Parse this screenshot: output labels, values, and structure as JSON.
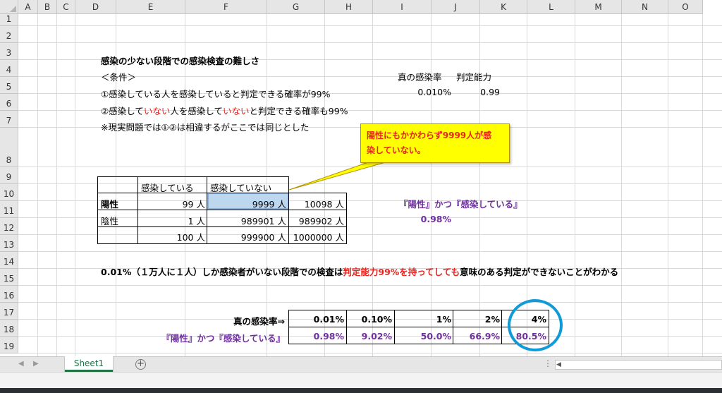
{
  "columns": [
    "A",
    "B",
    "C",
    "D",
    "E",
    "F",
    "G",
    "H",
    "I",
    "J",
    "K",
    "L",
    "M",
    "N",
    "O"
  ],
  "rows": [
    "1",
    "2",
    "3",
    "4",
    "5",
    "6",
    "7",
    "8",
    "9",
    "10",
    "11",
    "12",
    "13",
    "14",
    "15",
    "16",
    "17",
    "18",
    "19"
  ],
  "title": "感染の少ない段階での感染検査の難しさ",
  "conditions_label": "＜条件＞",
  "cond1": "①感染している人を感染していると判定できる確率が99%",
  "cond2": {
    "p1": "②感染して",
    "p2": "いない",
    "p3": "人を感染して",
    "p4": "いない",
    "p5": "と判定できる確率も99%"
  },
  "cond3": "※現実問題では①②は相違するがここでは同じとした",
  "params": {
    "rate_label": "真の感染率",
    "ability_label": "判定能力",
    "rate_value": "0.010%",
    "ability_value": "0.99"
  },
  "callout": {
    "line1": "陽性にもかかわらず9999人が感",
    "line2": "染していない。"
  },
  "table": {
    "header_infected": "感染している",
    "header_not_infected": "感染していない",
    "positive_label": "陽性",
    "negative_label": "陰性",
    "r10": [
      "99 人",
      "9999 人",
      "10098 人"
    ],
    "r11": [
      "1 人",
      "989901 人",
      "989902 人"
    ],
    "r12": [
      "100 人",
      "999900 人",
      "1000000 人"
    ]
  },
  "ppv_label": "『陽性』かつ『感染している』",
  "ppv_value": "0.98%",
  "conclusion": {
    "p1": "0.01%（１万人に１人）しか感染者がいない段階での検査は",
    "p2": "判定能力99%を持ってしても",
    "p3": "意味のある判定ができないことがわかる"
  },
  "summary": {
    "rate_label": "真の感染率⇒",
    "ppv_label": "『陽性』かつ『感染している』",
    "rates": [
      "0.01%",
      "0.10%",
      "1%",
      "2%",
      "4%"
    ],
    "ppvs": [
      "0.98%",
      "9.02%",
      "50.0%",
      "66.9%",
      "80.5%"
    ]
  },
  "sheet_tab": "Sheet1",
  "colors": {
    "accent_green": "#217346",
    "highlight_red": "#e8231e",
    "purple": "#7030a0",
    "callout_yellow": "#ffff00",
    "circle_blue": "#0f9ad8"
  }
}
